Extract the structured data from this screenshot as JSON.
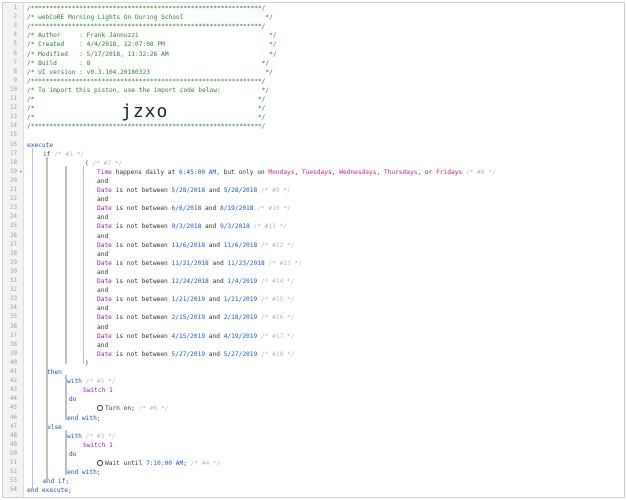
{
  "header": {
    "stars": "/**************************************************************/",
    "title": "/* webCoRE Morning Lights On During School                      */",
    "author": "/* Author     : Frank Jannuzzi                                   */",
    "created": "/* Created    : 4/4/2018, 12:07:08 PM                            */",
    "modified": "/* Modified   : 5/17/2018, 11:32:26 AM                           */",
    "build": "/* Build      : 8                                              */",
    "ui": "/* UI version : v0.3.104.20180323                               */",
    "import_text": "/* To import this piston, use the import code below:           */",
    "blank": "/*                                                            */",
    "import_code": "jzxo"
  },
  "code": {
    "execute": "execute",
    "if": "if",
    "if_comment": "/* #1 */",
    "paren_open": "(",
    "paren_comment": "/* #7 */",
    "time_line": {
      "a": "Time",
      "b": " happens daily at ",
      "c": "6:45:00 AM",
      "d": ", but only on ",
      "mon": "Mondays",
      "tue": "Tuesdays",
      "wed": "Wednesdays",
      "thu": "Thursdays",
      "fri": "Fridays",
      "cmt": "/* #8 */"
    },
    "and": "and",
    "date_word": "Date",
    "isnot": " is not between ",
    "and_word": " and ",
    "ranges": [
      {
        "from": "5/28/2018",
        "to": "5/28/2018",
        "cmt": "/* #9 */"
      },
      {
        "from": "6/6/2018",
        "to": "8/19/2018",
        "cmt": "/* #10 */"
      },
      {
        "from": "9/3/2018",
        "to": "9/3/2018",
        "cmt": "/* #11 */"
      },
      {
        "from": "11/6/2018",
        "to": "11/6/2018",
        "cmt": "/* #12 */"
      },
      {
        "from": "11/21/2018",
        "to": "11/23/2018",
        "cmt": "/* #13 */"
      },
      {
        "from": "12/24/2018",
        "to": "1/4/2019",
        "cmt": "/* #14 */"
      },
      {
        "from": "1/21/2019",
        "to": "1/21/2019",
        "cmt": "/* #15 */"
      },
      {
        "from": "2/15/2019",
        "to": "2/18/2019",
        "cmt": "/* #16 */"
      },
      {
        "from": "4/15/2019",
        "to": "4/19/2019",
        "cmt": "/* #17 */"
      },
      {
        "from": "5/27/2019",
        "to": "5/27/2019",
        "cmt": "/* #18 */"
      }
    ],
    "paren_close": ")",
    "then": "then",
    "with": "with",
    "with1_cmt": "/* #5 */",
    "switch1": "Switch 1",
    "do": "do",
    "turn_on": "Turn on;",
    "turn_on_cmt": "/* #6 */",
    "end_with": "end with;",
    "else": "else",
    "with2_cmt": "/* #3 */",
    "wait": "Wait until ",
    "wait_time": "7:10:00 AM",
    "wait_tail": ";",
    "wait_cmt": "/* #4 */",
    "end_if": "end if;",
    "end_execute": "end execute;"
  }
}
